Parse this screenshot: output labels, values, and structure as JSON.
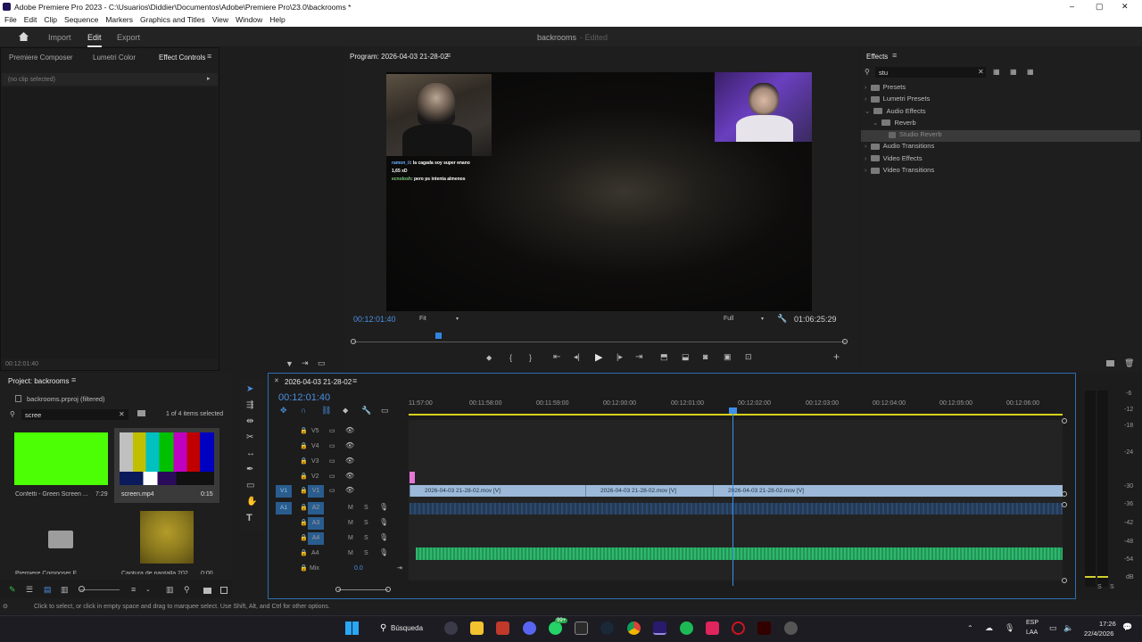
{
  "titlebar": {
    "title": "Adobe Premiere Pro 2023 - C:\\Usuarios\\Diddier\\Documentos\\Adobe\\Premiere Pro\\23.0\\backrooms *",
    "minimize": "–",
    "maximize": "▢",
    "close": "✕"
  },
  "menu": [
    "File",
    "Edit",
    "Clip",
    "Sequence",
    "Markers",
    "Graphics and Titles",
    "View",
    "Window",
    "Help"
  ],
  "header": {
    "tabs": [
      "Import",
      "Edit",
      "Export"
    ],
    "project_name": "backrooms",
    "status": "- Edited"
  },
  "source_panel": {
    "tabs": [
      "Premiere Composer",
      "Lumetri Color",
      "Effect Controls"
    ],
    "no_clip": "(no clip selected)",
    "timecode": "00:12:01:40"
  },
  "program": {
    "title": "Program: 2026-04-03 21-28-02",
    "timecode": "00:12:01:40",
    "fit": "Fit",
    "quality": "Full",
    "duration": "01:06:25:29",
    "chat_lines": [
      {
        "user": "ramon_ii",
        "text": ": la cagada soy super enano"
      },
      {
        "user": "",
        "text": "1,65 xD"
      },
      {
        "user": "ecnolosh",
        "text": ": pero ps intenta almenos"
      }
    ]
  },
  "effects": {
    "title": "Effects",
    "search": "stu",
    "tree": [
      {
        "label": "Presets",
        "level": 0,
        "open": false
      },
      {
        "label": "Lumetri Presets",
        "level": 0,
        "open": false
      },
      {
        "label": "Audio Effects",
        "level": 0,
        "open": true
      },
      {
        "label": "Reverb",
        "level": 1,
        "open": true
      },
      {
        "label": "Studio Reverb",
        "level": 2,
        "open": false
      },
      {
        "label": "Audio Transitions",
        "level": 0,
        "open": false
      },
      {
        "label": "Video Effects",
        "level": 0,
        "open": false
      },
      {
        "label": "Video Transitions",
        "level": 0,
        "open": false
      }
    ]
  },
  "project": {
    "title": "Project: backrooms",
    "file": "backrooms.prproj (filtered)",
    "search": "scree",
    "selection": "1 of 4 items selected",
    "items": [
      {
        "name": "Confetti - Green Screen ...",
        "duration": "7:29"
      },
      {
        "name": "screen.mp4",
        "duration": "0:15"
      },
      {
        "name": "Premiere Composer F...",
        "duration": ""
      },
      {
        "name": "Captura de pantalla 202...",
        "duration": "0:00"
      }
    ]
  },
  "timeline": {
    "sequence": "2026-04-03 21-28-02",
    "timecode": "00:12:01:40",
    "ruler": [
      "11:57:00",
      "00:11:58:00",
      "00:11:59:00",
      "00:12:00:00",
      "00:12:01:00",
      "00:12:02:00",
      "00:12:03:00",
      "00:12:04:00",
      "00:12:05:00",
      "00:12:06:00"
    ],
    "video_tracks": [
      "V5",
      "V4",
      "V3",
      "V2",
      "V1"
    ],
    "audio_tracks": [
      "A2",
      "A3",
      "A4"
    ],
    "audio_source": "A1",
    "video_source": "V1",
    "mix_label": "Mix",
    "mix_value": "0.0",
    "clip_names": [
      "2026-04-03 21-28-02.mov [V]",
      "2026-04-03 21-28-02.mov [V]",
      "2026-04-03 21-28-02.mov [V]"
    ],
    "track_buttons": {
      "m": "M",
      "s": "S"
    }
  },
  "meter_scale": [
    "-6",
    "-12",
    "-18",
    "-24",
    "-30",
    "-36",
    "-42",
    "-48",
    "-54",
    "dB"
  ],
  "meter_solo": [
    "S",
    "S"
  ],
  "status_bar": "Click to select, or click in empty space and drag to marquee select. Use Shift, Alt, and Ctrl for other options.",
  "taskbar": {
    "search": "Búsqueda",
    "lang": "ESP",
    "lang2": "LAA",
    "time": "17:26",
    "date": "22/4/2026",
    "badge": "99+"
  }
}
